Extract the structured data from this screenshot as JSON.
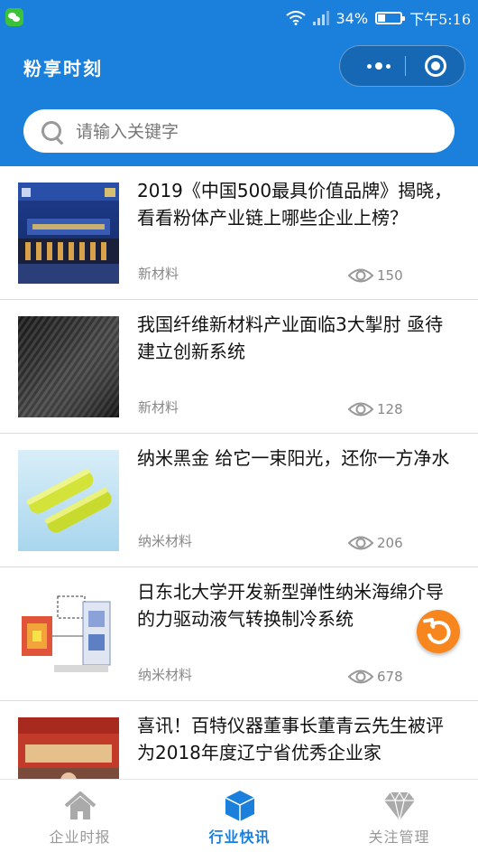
{
  "status": {
    "battery": "34%",
    "battery_level": 0.34,
    "time": "下午5:16"
  },
  "nav": {
    "title": "粉享时刻"
  },
  "search": {
    "placeholder": "请输入关键字"
  },
  "articles": [
    {
      "title": "2019《中国500最具价值品牌》揭晓，看看粉体产业链上哪些企业上榜？",
      "category": "新材料",
      "views": "150"
    },
    {
      "title": "我国纤维新材料产业面临3大掣肘 亟待建立创新系统",
      "category": "新材料",
      "views": "128"
    },
    {
      "title": "纳米黑金 给它一束阳光，还你一方净水",
      "category": "纳米材料",
      "views": "206"
    },
    {
      "title": "日东北大学开发新型弹性纳米海绵介导的力驱动液气转换制冷系统",
      "category": "纳米材料",
      "views": "678"
    },
    {
      "title": "喜讯！百特仪器董事长董青云先生被评为2018年度辽宁省优秀企业家",
      "category": "",
      "views": ""
    }
  ],
  "tabs": [
    {
      "label": "企业时报",
      "icon": "home-icon",
      "active": false
    },
    {
      "label": "行业快讯",
      "icon": "cube-icon",
      "active": true
    },
    {
      "label": "关注管理",
      "icon": "diamond-icon",
      "active": false
    }
  ],
  "colors": {
    "primary": "#1b7fdc",
    "fab": "#f7861f",
    "text": "#111111",
    "meta": "#888888"
  }
}
